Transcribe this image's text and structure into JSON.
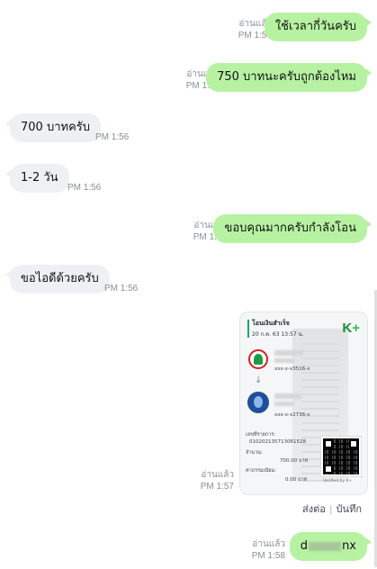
{
  "messages": [
    {
      "dir": "out",
      "text": "ใช้เวลากี่วันครับ",
      "read": "อ่านแล้ว",
      "time": "PM 1:55"
    },
    {
      "dir": "out",
      "text": "750 บาทนะครับถูกต้องไหม",
      "read": "อ่านแล้ว",
      "time": "PM 1:56"
    },
    {
      "dir": "in",
      "text": "700 บาทครับ",
      "time": "PM 1:56"
    },
    {
      "dir": "in",
      "text": "1-2 วัน",
      "time": "PM 1:56"
    },
    {
      "dir": "out",
      "text": "ขอบคุณมากครับกำลังโอน",
      "read": "อ่านแล้ว",
      "time": "PM 1:56"
    },
    {
      "dir": "in",
      "text": "ขอไอดีด้วยครับ",
      "time": "PM 1:56"
    },
    {
      "dir": "out",
      "type": "image",
      "read": "อ่านแล้ว",
      "time": "PM 1:57"
    },
    {
      "dir": "out",
      "text_prefix": "d",
      "text_suffix": "nx",
      "read": "อ่านแล้ว",
      "time": "PM 1:58"
    }
  ],
  "slip": {
    "title": "โอนเงินสำเร็จ",
    "datetime": "20 ก.ค. 63  13:57 น.",
    "brand": "K",
    "brand_plus": "+",
    "from_acct": "xxx-x-x3516-x",
    "to_acct": "xxx-x-x2736-x",
    "ref_label": "เลขที่รายการ:",
    "ref_value": "010202135713061528",
    "amount_label": "จำนวน:",
    "amount_value": "700.00 บาท",
    "fee_label": "ค่าธรรมเนียม:",
    "fee_value": "0.00 บาท",
    "verified": "Verified by K+"
  },
  "image_actions": {
    "share": "ส่งต่อ",
    "save": "บันทึก"
  },
  "colors": {
    "outgoing_bubble": "#b7f2a3",
    "incoming_bubble": "#eef0f3",
    "meta_text": "#8a8f95"
  }
}
